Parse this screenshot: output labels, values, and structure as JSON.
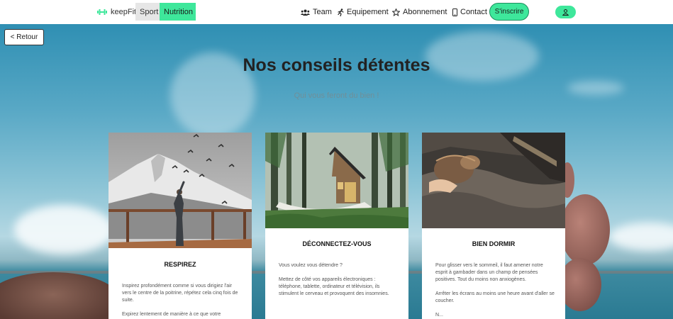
{
  "navbar": {
    "brand": "keepFit",
    "sport": "Sport",
    "nutrition": "Nutrition",
    "links": {
      "team": "Team",
      "equipement": "Equipement",
      "abonnement": "Abonnement",
      "contact": "Contact"
    },
    "signup": "S'inscrire"
  },
  "back_button": "< Retour",
  "page": {
    "title": "Nos conseils détentes",
    "subtitle": "Qui vous feront du bien !"
  },
  "cards": [
    {
      "title": "RESPIREZ",
      "paragraphs": [
        "Inspirez profondément comme si vous dirigiez l'air vers le centre de la poitrine, répétez cela cinq fois de suite.",
        "Expirez lentement de manière à ce que votre"
      ]
    },
    {
      "title": "DÉCONNECTEZ-VOUS",
      "paragraphs": [
        "Vous voulez vous détendre ?",
        "Mettez de côté vos appareils électroniques : téléphone, tablette, ordinateur et télévision, ils stimulent le cerveau et provoquent des insomnies."
      ]
    },
    {
      "title": "BIEN DORMIR",
      "paragraphs": [
        "Pour glisser vers le sommeil, il faut amener notre esprit à gambader dans un champ de pensées positives. Tout du moins non anxiogènes.",
        "Arrêter les écrans au moins une heure avant d'aller se coucher.",
        "N..."
      ]
    }
  ],
  "colors": {
    "accent": "#3ee79b",
    "navbar_bg": "#ffffff"
  }
}
